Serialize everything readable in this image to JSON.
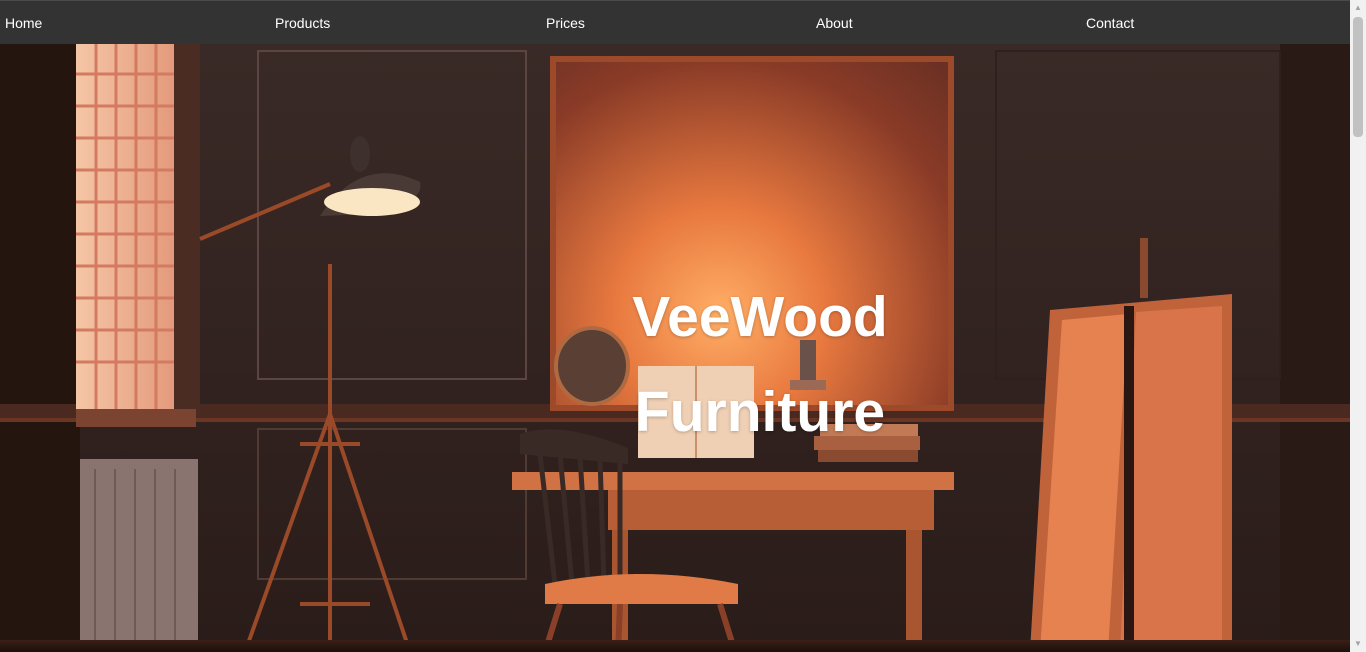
{
  "nav": {
    "items": [
      {
        "label": "Home"
      },
      {
        "label": "Products"
      },
      {
        "label": "Prices"
      },
      {
        "label": "About"
      },
      {
        "label": "Contact"
      }
    ]
  },
  "hero": {
    "title_line1": "VeeWood",
    "title_line2": "Furniture",
    "image_icon": "room-interior-illustration"
  },
  "scrollbar": {
    "up_icon": "arrow-up-icon",
    "down_icon": "arrow-down-icon"
  },
  "colors": {
    "navbar_bg": "#333333",
    "nav_text": "#ffffff",
    "hero_text": "#ffffff"
  }
}
